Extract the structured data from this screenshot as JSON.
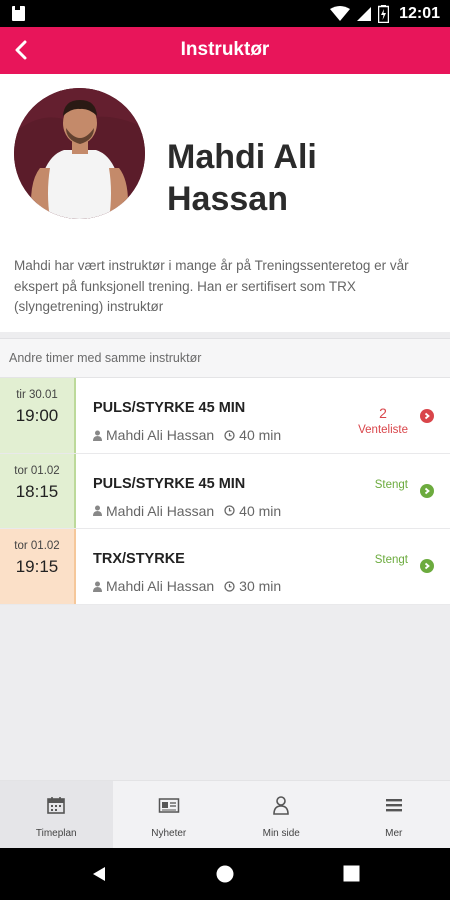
{
  "status_bar": {
    "time": "12:01"
  },
  "app_bar": {
    "title": "Instruktør",
    "back_icon": "back-chevron-icon"
  },
  "instructor": {
    "name": "Mahdi Ali Hassan",
    "bio": "Mahdi har vært instruktør i mange år på Treningssenteretog er vår ekspert på funksjonell trening. Han er sertifisert som TRX (slyngetrening) instruktør"
  },
  "section": {
    "title": "Andre timer med samme instruktør"
  },
  "sessions": [
    {
      "date": "tir 30.01",
      "time": "19:00",
      "name": "PULS/STYRKE 45 MIN",
      "instructor": "Mahdi Ali Hassan",
      "duration": "40 min",
      "status_count": "2",
      "status": "Venteliste",
      "color": "#d9454a"
    },
    {
      "date": "tor 01.02",
      "time": "18:15",
      "name": "PULS/STYRKE 45 MIN",
      "instructor": "Mahdi Ali Hassan",
      "duration": "40 min",
      "status": "Stengt",
      "color": "#6cab3e"
    },
    {
      "date": "tor 01.02",
      "time": "19:15",
      "name": "TRX/STYRKE",
      "instructor": "Mahdi Ali Hassan",
      "duration": "30 min",
      "status": "Stengt",
      "color": "#6cab3e"
    }
  ],
  "tabs": [
    {
      "label": "Timeplan",
      "icon": "calendar-icon",
      "active": true
    },
    {
      "label": "Nyheter",
      "icon": "news-icon"
    },
    {
      "label": "Min side",
      "icon": "user-icon"
    },
    {
      "label": "Mer",
      "icon": "menu-icon"
    }
  ],
  "colors": {
    "accent": "#e8155a",
    "green": "#6cab3e",
    "red": "#d9454a"
  }
}
